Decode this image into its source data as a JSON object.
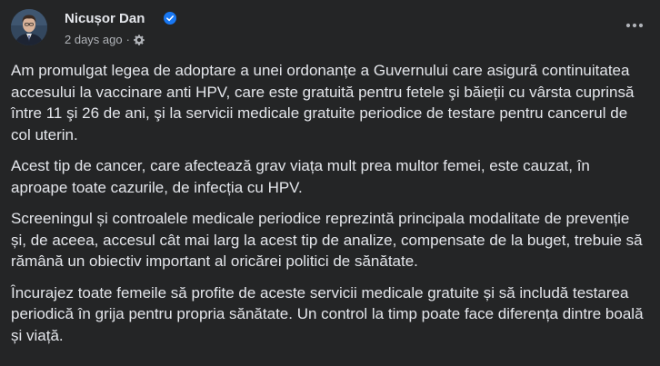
{
  "post": {
    "author": "Nicușor Dan",
    "timestamp": "2 days ago",
    "separator": "·",
    "paragraphs": [
      "Am promulgat legea de adoptare a unei ordonanțe a Guvernului care asigură continuitatea accesului la vaccinare anti HPV, care este gratuită pentru fetele şi băieții cu vârsta cuprinsă între 11 şi 26 de ani, şi la servicii medicale gratuite periodice de testare pentru cancerul de col uterin.",
      "Acest tip de cancer, care afectează grav viața mult prea multor femei, este cauzat, în aproape toate cazurile, de infecția cu HPV.",
      "Screeningul și controalele medicale periodice reprezintă principala modalitate de prevenție și, de aceea, accesul cât mai larg la acest tip de analize, compensate de la buget, trebuie să rămână un obiectiv important al oricărei politici de sănătate.",
      "Încurajez toate femeile să profite de aceste servicii medicale gratuite și să includă testarea periodică în grija pentru propria sănătate. Un control la timp poate face diferența dintre boală și viață."
    ]
  },
  "icons": {
    "verified": "verified-badge-icon",
    "privacy": "gear-icon",
    "more": "more-options-icon"
  },
  "colors": {
    "background": "#242526",
    "text_primary": "#e4e6eb",
    "text_secondary": "#b0b3b8",
    "verified_blue": "#1877f2"
  }
}
